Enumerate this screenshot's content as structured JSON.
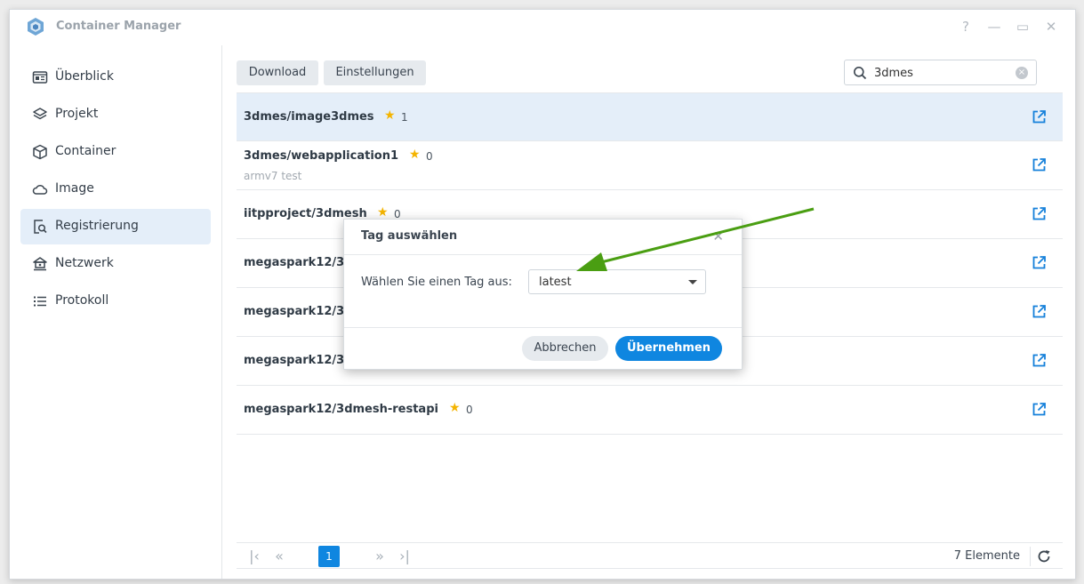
{
  "window": {
    "title": "Container Manager",
    "controls": {
      "help": "?",
      "minimize": "—",
      "maximize": "▭",
      "close": "✕"
    }
  },
  "sidebar": {
    "items": [
      {
        "label": "Überblick",
        "icon": "overview-icon"
      },
      {
        "label": "Projekt",
        "icon": "layers-icon"
      },
      {
        "label": "Container",
        "icon": "cube-icon"
      },
      {
        "label": "Image",
        "icon": "cloud-icon"
      },
      {
        "label": "Registrierung",
        "icon": "registry-search-icon",
        "active": true
      },
      {
        "label": "Netzwerk",
        "icon": "network-icon"
      },
      {
        "label": "Protokoll",
        "icon": "list-icon"
      }
    ]
  },
  "toolbar": {
    "download_label": "Download",
    "settings_label": "Einstellungen",
    "search_value": "3dmes"
  },
  "list": {
    "rows": [
      {
        "name": "3dmes/image3dmes",
        "stars": "1",
        "description": "",
        "selected": true
      },
      {
        "name": "3dmes/webapplication1",
        "stars": "0",
        "description": "armv7 test"
      },
      {
        "name": "iitpproject/3dmesh",
        "stars": "0",
        "description": ""
      },
      {
        "name": "megaspark12/3",
        "stars": "",
        "description": ""
      },
      {
        "name": "megaspark12/3",
        "stars": "",
        "description": ""
      },
      {
        "name": "megaspark12/3",
        "stars": "",
        "description": ""
      },
      {
        "name": "megaspark12/3dmesh-restapi",
        "stars": "0",
        "description": ""
      }
    ]
  },
  "pager": {
    "current_page": "1",
    "total_label": "7 Elemente"
  },
  "dialog": {
    "title": "Tag auswählen",
    "label": "Wählen Sie einen Tag aus:",
    "selected_tag": "latest",
    "cancel_label": "Abbrechen",
    "ok_label": "Übernehmen"
  },
  "colors": {
    "accent": "#0f86e0",
    "selection": "#e4eef9",
    "star": "#f4b400",
    "annotation_arrow": "#4a9e12"
  }
}
